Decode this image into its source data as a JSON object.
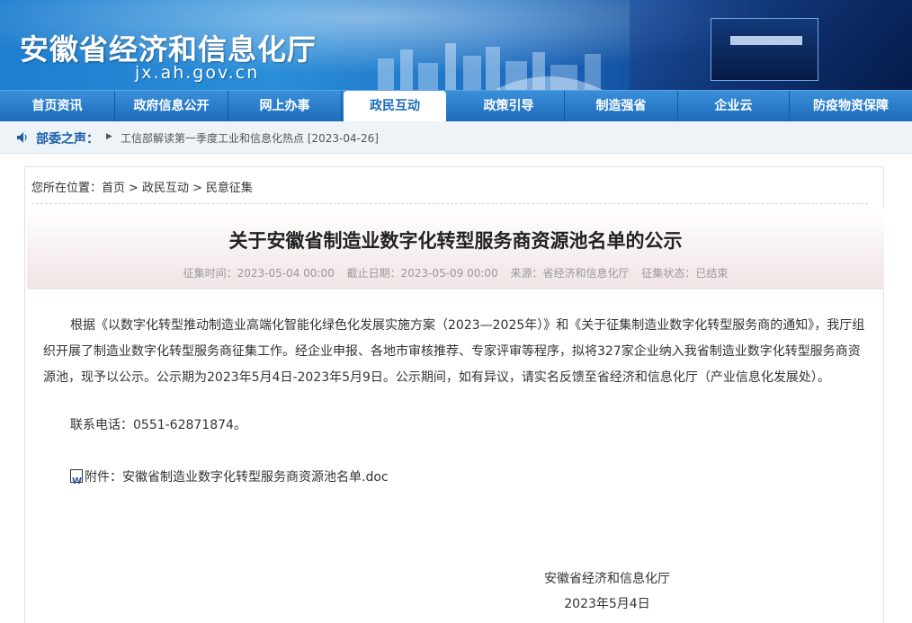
{
  "site": {
    "title": "安徽省经济和信息化厅",
    "domain": "jx.ah.gov.cn"
  },
  "nav": {
    "items": [
      {
        "label": "首页资讯"
      },
      {
        "label": "政府信息公开"
      },
      {
        "label": "网上办事"
      },
      {
        "label": "政民互动"
      },
      {
        "label": "政策引导"
      },
      {
        "label": "制造强省"
      },
      {
        "label": "企业云"
      },
      {
        "label": "防疫物资保障"
      }
    ],
    "active": "政民互动"
  },
  "notice": {
    "label": "部委之声：",
    "text": "工信部解读第一季度工业和信息化热点 [2023-04-26]"
  },
  "breadcrumb": {
    "prefix": "您所在位置：",
    "items": [
      "首页",
      "政民互动",
      "民意征集"
    ],
    "separator": ">"
  },
  "article": {
    "title": "关于安徽省制造业数字化转型服务商资源池名单的公示",
    "meta": {
      "collect_time": "征集时间：2023-05-04 00:00",
      "deadline": "截止日期：2023-05-09 00:00",
      "source": "来源：省经济和信息化厅",
      "status": "征集状态：已结束"
    },
    "body_1": "根据《以数字化转型推动制造业高端化智能化绿色化发展实施方案（2023—2025年）》和《关于征集制造业数字化转型服务商的通知》，我厅组织开展了制造业数字化转型服务商征集工作。经企业申报、各地市审核推荐、专家评审等程序，拟将327家企业纳入我省制造业数字化转型服务商资源池，现予以公示。公示期为2023年5月4日-2023年5月9日。公示期间，如有异议，请实名反馈至省经济和信息化厅（产业信息化发展处）。",
    "contact": "联系电话：0551-62871874。",
    "attachment_label": "附件：",
    "attachment_name": "安徽省制造业数字化转型服务商资源池名单.doc",
    "signature_org": "安徽省经济和信息化厅",
    "signature_date": "2023年5月4日"
  },
  "colors": {
    "nav_blue": "#1c6cbc",
    "notice_label": "#1c5fa8",
    "meta_gray": "#999999"
  }
}
